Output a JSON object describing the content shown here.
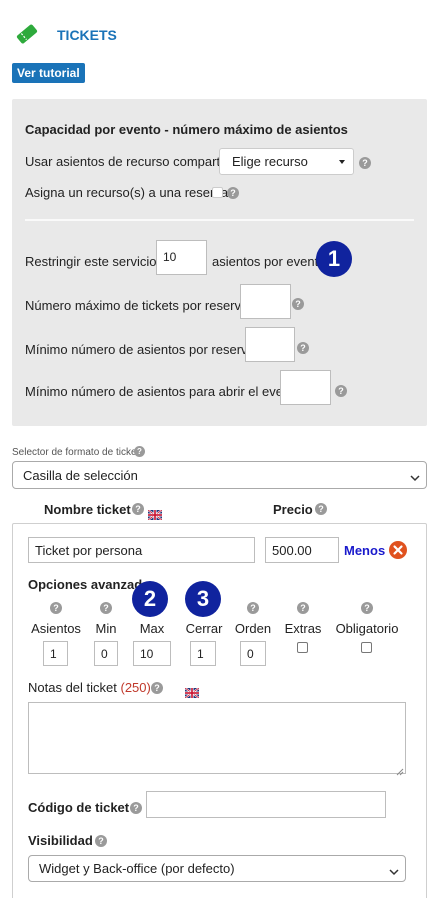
{
  "header": {
    "title": "TICKETS",
    "tutorial_label": "Ver tutorial"
  },
  "capacity": {
    "section_title": "Capacidad por evento - número máximo de asientos",
    "shared_label": "Usar asientos de recurso compartido",
    "shared_select": "Elige recurso",
    "assign_label": "Asigna un recurso(s) a una reserva",
    "restrict_prefix": "Restringir este servicio a",
    "restrict_value": "10",
    "restrict_suffix": "asientos por evento",
    "max_tickets_label": "Número máximo de tickets por reserva:",
    "max_tickets_value": "",
    "min_seats_label": "Mínimo número de asientos por reserva:",
    "min_seats_value": "",
    "min_open_label": "Mínimo número de asientos para abrir el evento:",
    "min_open_value": ""
  },
  "format": {
    "label": "Selector de formato de ticket",
    "value": "Casilla de selección"
  },
  "ticket_table": {
    "name_header": "Nombre ticket",
    "price_header": "Precio",
    "name_value": "Ticket por persona",
    "price_value": "500.00",
    "remove_label": "Menos",
    "advanced_label": "Opciones avanzadas",
    "columns": [
      {
        "label": "Asientos",
        "value": "1"
      },
      {
        "label": "Min",
        "value": "0"
      },
      {
        "label": "Max",
        "value": "10"
      },
      {
        "label": "Cerrar",
        "value": "1"
      },
      {
        "label": "Orden",
        "value": "0"
      },
      {
        "label": "Extras",
        "value": ""
      },
      {
        "label": "Obligatorio",
        "value": ""
      }
    ],
    "notes_label": "Notas del ticket",
    "notes_count": "(250)",
    "notes_value": "",
    "code_label": "Código de ticket",
    "code_value": "",
    "visibility_label": "Visibilidad",
    "visibility_value": "Widget y Back-office (por defecto)"
  },
  "markers": {
    "one": "1",
    "two": "2",
    "three": "3"
  },
  "colors": {
    "accent": "#1a73b8",
    "marker": "#10239e",
    "remove": "#e0521f",
    "ticket_icon": "#2eaa3c"
  }
}
